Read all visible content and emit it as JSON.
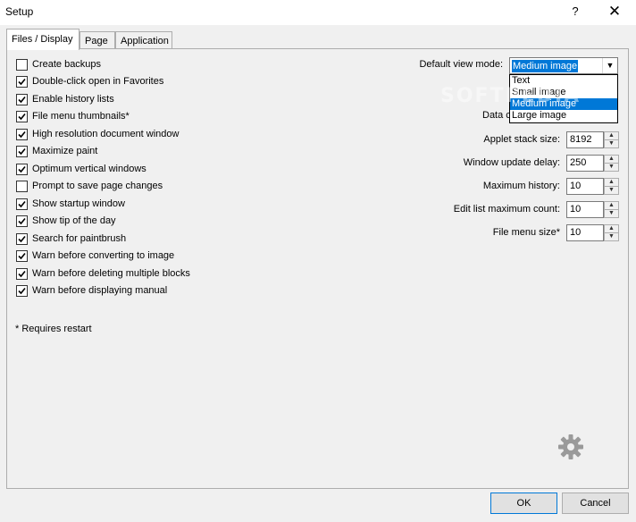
{
  "window": {
    "title": "Setup",
    "help_label": "?",
    "close_label": "✕"
  },
  "tabs": [
    "Files / Display",
    "Page",
    "Application"
  ],
  "checkboxes": [
    {
      "label": "Create backups",
      "checked": false
    },
    {
      "label": "Double-click open in Favorites",
      "checked": true
    },
    {
      "label": "Enable history lists",
      "checked": true
    },
    {
      "label": "File menu thumbnails*",
      "checked": true
    },
    {
      "label": "High resolution document window",
      "checked": true
    },
    {
      "label": "Maximize paint",
      "checked": true
    },
    {
      "label": "Optimum vertical windows",
      "checked": true
    },
    {
      "label": "Prompt to save page changes",
      "checked": false
    },
    {
      "label": "Show startup window",
      "checked": true
    },
    {
      "label": "Show tip of the day",
      "checked": true
    },
    {
      "label": "Search for paintbrush",
      "checked": true
    },
    {
      "label": "Warn before converting to image",
      "checked": true
    },
    {
      "label": "Warn before deleting multiple blocks",
      "checked": true
    },
    {
      "label": "Warn before displaying manual",
      "checked": true
    }
  ],
  "note": "* Requires restart",
  "view_mode": {
    "label": "Default view mode:",
    "value": "Medium image",
    "options": [
      "Text",
      "Small image",
      "Medium image",
      "Large image"
    ],
    "selected_index": 2
  },
  "partial_label": "Data c",
  "spinners": [
    {
      "label": "Applet stack size:",
      "value": "8192"
    },
    {
      "label": "Window update delay:",
      "value": "250"
    },
    {
      "label": "Maximum history:",
      "value": "10"
    },
    {
      "label": "Edit list maximum count:",
      "value": "10"
    },
    {
      "label": "File menu size*",
      "value": "10"
    }
  ],
  "watermark": "SOFTPEDIA",
  "buttons": {
    "ok": "OK",
    "cancel": "Cancel"
  },
  "colors": {
    "accent": "#0078d7",
    "window_bg": "#f0f0f0"
  }
}
